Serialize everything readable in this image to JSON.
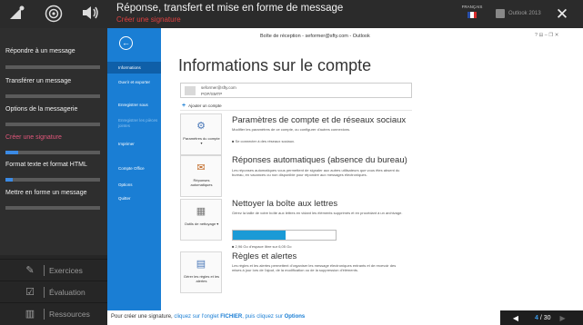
{
  "header": {
    "title": "Réponse, transfert et mise en forme de message",
    "subtitle": "Créer une signature",
    "language": "FRANÇAIS",
    "product": "Outlook 2013",
    "icons": [
      "brightness-icon",
      "target-icon",
      "volume-icon"
    ]
  },
  "sidebar": {
    "chapters": [
      {
        "label": "Répondre à un message",
        "progress": 0,
        "active": false
      },
      {
        "label": "Transférer un message",
        "progress": 0,
        "active": false
      },
      {
        "label": "Options de la messagerie",
        "progress": 0,
        "active": false
      },
      {
        "label": "Créer une signature",
        "progress": 0.13,
        "active": true
      },
      {
        "label": "Format texte et format HTML",
        "progress": 0.08,
        "active": false
      },
      {
        "label": "Mettre en forme un message",
        "progress": 0,
        "active": false
      }
    ],
    "bottom": [
      {
        "label": "Exercices",
        "icon": "pencil-icon"
      },
      {
        "label": "Évaluation",
        "icon": "checkbox-icon"
      },
      {
        "label": "Ressources",
        "icon": "book-icon"
      }
    ]
  },
  "outlook": {
    "window_title": "Boîte de réception - seformer@sfty.com - Outlook",
    "window_controls": "?   ⊟   –   ❐   ✕",
    "nav": [
      "Informations",
      "Ouvrir et exporter",
      "Enregistrer sous",
      "Enregistrer les pièces jointes",
      "Imprimer",
      "Compte Office",
      "Options",
      "Quitter"
    ],
    "page_title": "Informations sur le compte",
    "account_email": "seformer@sfty.com",
    "account_type": "POP/SMTP",
    "add_account": "Ajouter un compte",
    "sections": [
      {
        "tile": "Paramètres du compte ▾",
        "heading": "Paramètres de compte et de réseaux sociaux",
        "desc": "Modifier les paramètres de ce compte, ou configurer d'autres connexions.",
        "bullet": "■  Se connecter à des réseaux sociaux."
      },
      {
        "tile": "Réponses automatiques",
        "heading": "Réponses automatiques (absence du bureau)",
        "desc": "Les réponses automatiques vous permettent de signaler aux autres utilisateurs que vous êtes absent du bureau, en vacances ou non disponible pour répondre aux messages électroniques.",
        "bullet": ""
      },
      {
        "tile": "Outils de nettoyage ▾",
        "heading": "Nettoyer la boîte aux lettres",
        "desc": "Gérez la taille de votre boîte aux lettres en vidant les éléments supprimés et en procédant à un archivage.",
        "bullet": "■  2,96 Go d'espace libre sur 6,05 Go",
        "usage": 0.51
      },
      {
        "tile": "Gérer les règles et les alertes",
        "heading": "Règles et alertes",
        "desc": "Les règles et les alertes permettent d'organiser les message électroniques entrants et de recevoir des mises à jour lors de l'ajout, de la modification ou de la suppression d'éléments.",
        "bullet": ""
      }
    ]
  },
  "footer": {
    "instruction_prefix": "Pour créer une signature, ",
    "instruction_link1": "cliquez sur l'onglet ",
    "instruction_kw1": "FICHIER",
    "instruction_link2": ", puis cliquez sur ",
    "instruction_kw2": "Options",
    "page_current": "4",
    "page_total": "/ 30"
  },
  "colors": {
    "accent_blue": "#1a7ed4",
    "active_chapter": "#e0567a",
    "progress": "#3b8ae4"
  }
}
